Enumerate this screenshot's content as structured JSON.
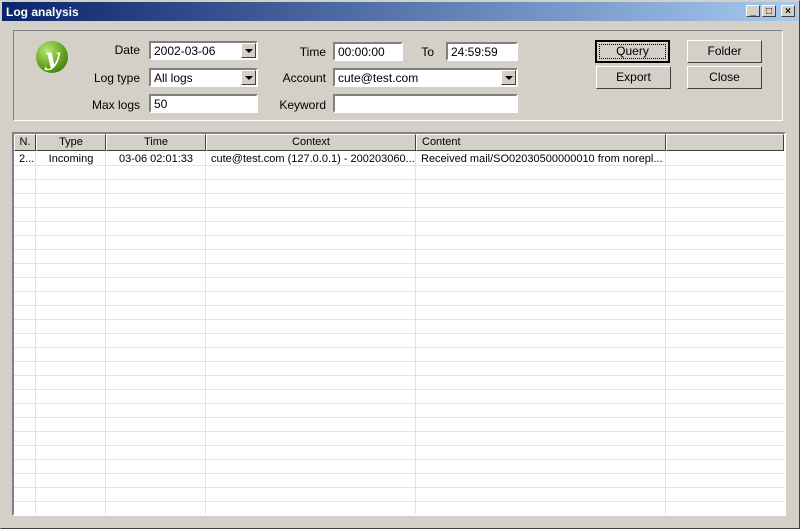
{
  "window": {
    "title": "Log analysis",
    "controls": [
      "_",
      "□",
      "×"
    ]
  },
  "logo": {
    "glyph": "y",
    "icon": "app-logo-icon"
  },
  "form": {
    "date_label": "Date",
    "date_value": "2002-03-06",
    "logtype_label": "Log type",
    "logtype_value": "All logs",
    "maxlogs_label": "Max logs",
    "maxlogs_value": "50",
    "time_label": "Time",
    "time_from": "00:00:00",
    "to_label": "To",
    "time_to": "24:59:59",
    "account_label": "Account",
    "account_value": "cute@test.com",
    "keyword_label": "Keyword",
    "keyword_value": ""
  },
  "buttons": {
    "query": "Query",
    "export": "Export",
    "folder": "Folder",
    "close": "Close"
  },
  "table": {
    "columns": [
      "N.",
      "Type",
      "Time",
      "Context",
      "Content"
    ],
    "rows": [
      [
        "2...",
        "Incoming",
        "03-06 02:01:33",
        "cute@test.com (127.0.0.1) - 200203060...",
        "Received mail/SO02030500000010 from norepl..."
      ]
    ]
  }
}
